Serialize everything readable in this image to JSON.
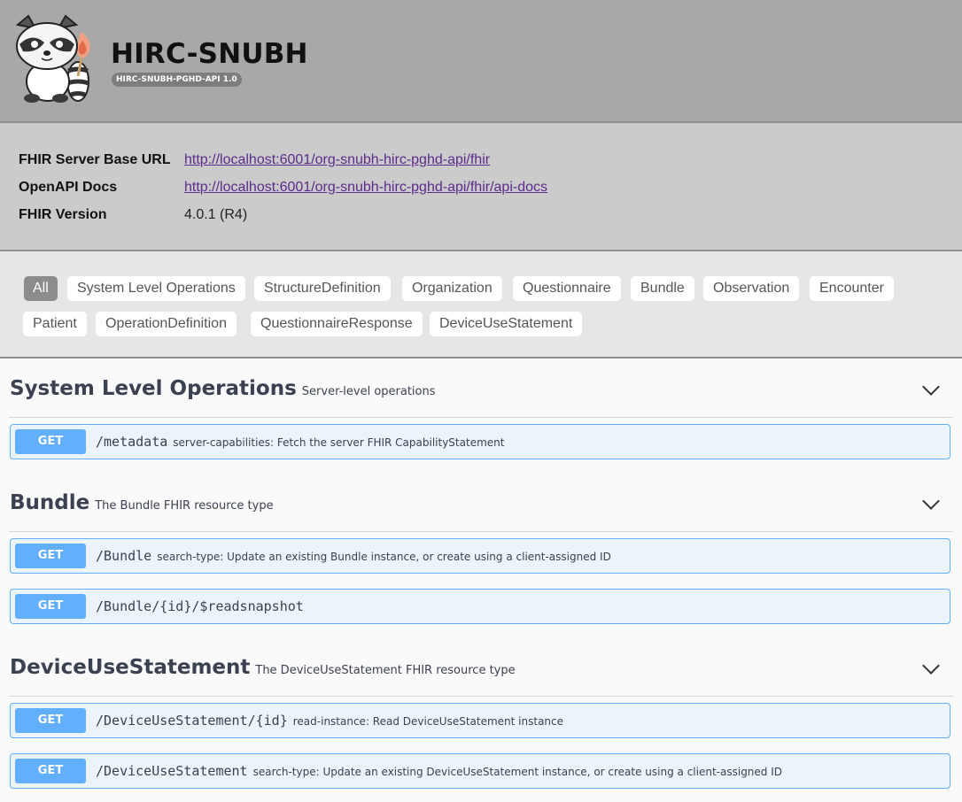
{
  "header": {
    "title": "HIRC-SNUBH",
    "version": "HIRC-SNUBH-PGHD-API 1.0",
    "logo_icon": "raccoon-mascot-logo"
  },
  "info": {
    "rows": [
      {
        "label": "FHIR Server Base URL",
        "value": "http://localhost:6001/org-snubh-hirc-pghd-api/fhir"
      },
      {
        "label": "OpenAPI Docs",
        "value": "http://localhost:6001/org-snubh-hirc-pghd-api/fhir/api-docs"
      },
      {
        "label": "FHIR Version",
        "value": "4.0.1 (R4)"
      }
    ]
  },
  "filters": [
    "All",
    "System Level Operations",
    "StructureDefinition",
    "Organization",
    "Questionnaire",
    "Bundle",
    "Observation",
    "Encounter",
    "Patient",
    "OperationDefinition",
    "QuestionnaireResponse",
    "DeviceUseStatement"
  ],
  "sections": [
    {
      "title": "System Level Operations",
      "description": "Server-level operations",
      "ops": [
        {
          "method": "GET",
          "path": "/metadata",
          "summary": "server-capabilities: Fetch the server FHIR CapabilityStatement"
        }
      ]
    },
    {
      "title": "Bundle",
      "description": "The Bundle FHIR resource type",
      "ops": [
        {
          "method": "GET",
          "path": "/Bundle",
          "summary": "search-type: Update an existing Bundle instance, or create using a client-assigned ID"
        },
        {
          "method": "GET",
          "path": "/Bundle/{id}/$readsnapshot",
          "summary": ""
        }
      ]
    },
    {
      "title": "DeviceUseStatement",
      "description": "The DeviceUseStatement FHIR resource type",
      "ops": [
        {
          "method": "GET",
          "path": "/DeviceUseStatement/{id}",
          "summary": "read-instance: Read DeviceUseStatement instance"
        },
        {
          "method": "GET",
          "path": "/DeviceUseStatement",
          "summary": "search-type: Update an existing DeviceUseStatement instance, or create using a client-assigned ID"
        }
      ]
    }
  ],
  "colors": {
    "get_method": "#61affe",
    "op_background": "#ebf3fb",
    "header_bg": "#a8a8a8"
  }
}
